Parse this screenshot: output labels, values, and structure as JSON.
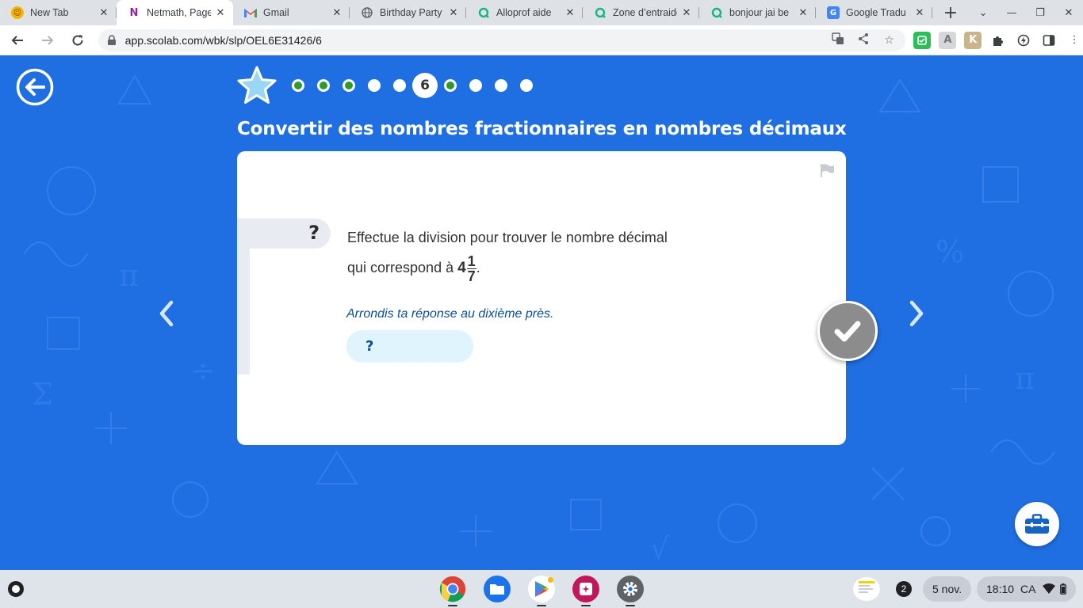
{
  "browser": {
    "tabs": [
      {
        "title": "New Tab",
        "favicon": "cookie-smiley-icon",
        "active": false
      },
      {
        "title": "Netmath, Page",
        "favicon": "netmath-icon",
        "active": true
      },
      {
        "title": "Gmail",
        "favicon": "gmail-icon",
        "active": false
      },
      {
        "title": "Birthday Party",
        "favicon": "globe-icon",
        "active": false
      },
      {
        "title": "Alloprof aide",
        "favicon": "alloprof-icon",
        "active": false
      },
      {
        "title": "Zone d’entraide",
        "favicon": "alloprof-icon",
        "active": false
      },
      {
        "title": "bonjour jai be",
        "favicon": "alloprof-icon",
        "active": false
      },
      {
        "title": "Google Tradu",
        "favicon": "google-translate-icon",
        "active": false
      }
    ],
    "url": "app.scolab.com/wbk/slp/OEL6E31426/6"
  },
  "exercise": {
    "title": "Convertir des nombres fractionnaires en nombres décimaux",
    "progress": {
      "total": 10,
      "current_index": 6,
      "current_label": "6",
      "states": [
        "done",
        "done",
        "done",
        "todo",
        "todo",
        "current",
        "done",
        "todo",
        "todo",
        "todo"
      ]
    },
    "question": {
      "marker": "?",
      "line1": "Effectue la division pour trouver le nombre décimal",
      "line2_prefix": "qui correspond à ",
      "whole": "4",
      "numerator": "1",
      "denominator": "7",
      "line2_suffix": "."
    },
    "hint": "Arrondis ta réponse au dixième près.",
    "answer_placeholder": "?"
  },
  "shelf": {
    "date": "5 nov.",
    "time": "18:10",
    "locale": "CA",
    "notifications": "2"
  },
  "colors": {
    "page_bg": "#1f6fe3",
    "done_dot": "#2e9a2a",
    "hint_text": "#0b4f94",
    "answer_bg": "#dff4fc",
    "check_btn": "#8c8c8c"
  }
}
